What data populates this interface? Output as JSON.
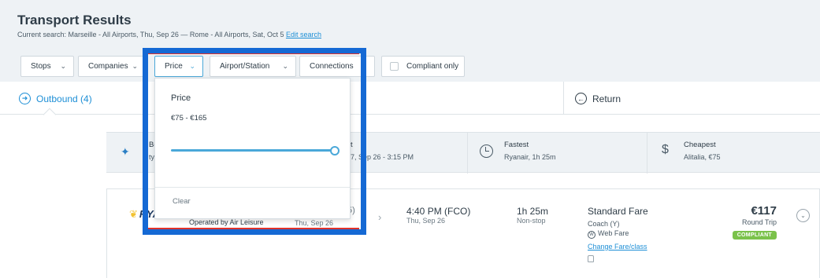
{
  "header": {
    "title": "Transport Results",
    "search_prefix": "Current search: Marseille - All Airports, Thu, Sep 26 — Rome - All Airports, Sat, Oct 5",
    "edit_link": "Edit search"
  },
  "filters": {
    "stops": "Stops",
    "companies": "Companies",
    "price": "Price",
    "airport_station": "Airport/Station",
    "connections": "Connections",
    "compliant_only": "Compliant only"
  },
  "tabs": {
    "outbound": "Outbound (4)",
    "return": "Return"
  },
  "summary": {
    "best_label": "Be",
    "best_sub": "ty",
    "cell2_label": "t",
    "cell2_value": "7, Sep 26 - 3:15 PM",
    "fastest_label": "Fastest",
    "fastest_value": "Ryanair, 1h 25m",
    "cheapest_label": "Cheapest",
    "cheapest_value": "Alitalia, €75"
  },
  "result": {
    "operated_by": "Operated by Air Leisure",
    "depart_date": "Thu, Sep 26",
    "partial": "5)",
    "arrive_time": "4:40 PM (FCO)",
    "arrive_date": "Thu, Sep 26",
    "duration": "1h 25m",
    "stops": "Non-stop",
    "fare_name": "Standard Fare",
    "cabin": "Coach (Y)",
    "web_fare": "Web Fare",
    "change_link": "Change Fare/class",
    "price": "€117",
    "trip_type": "Round Trip",
    "badge": "COMPLIANT"
  },
  "price_panel": {
    "title": "Price",
    "range": "€75 - €165",
    "slider_min": 75,
    "slider_max": 165,
    "slider_value": 165,
    "clear": "Clear"
  },
  "colors": {
    "accent": "#1e8fd6",
    "highlight": "#1569d4",
    "compliant": "#7bc24b"
  }
}
